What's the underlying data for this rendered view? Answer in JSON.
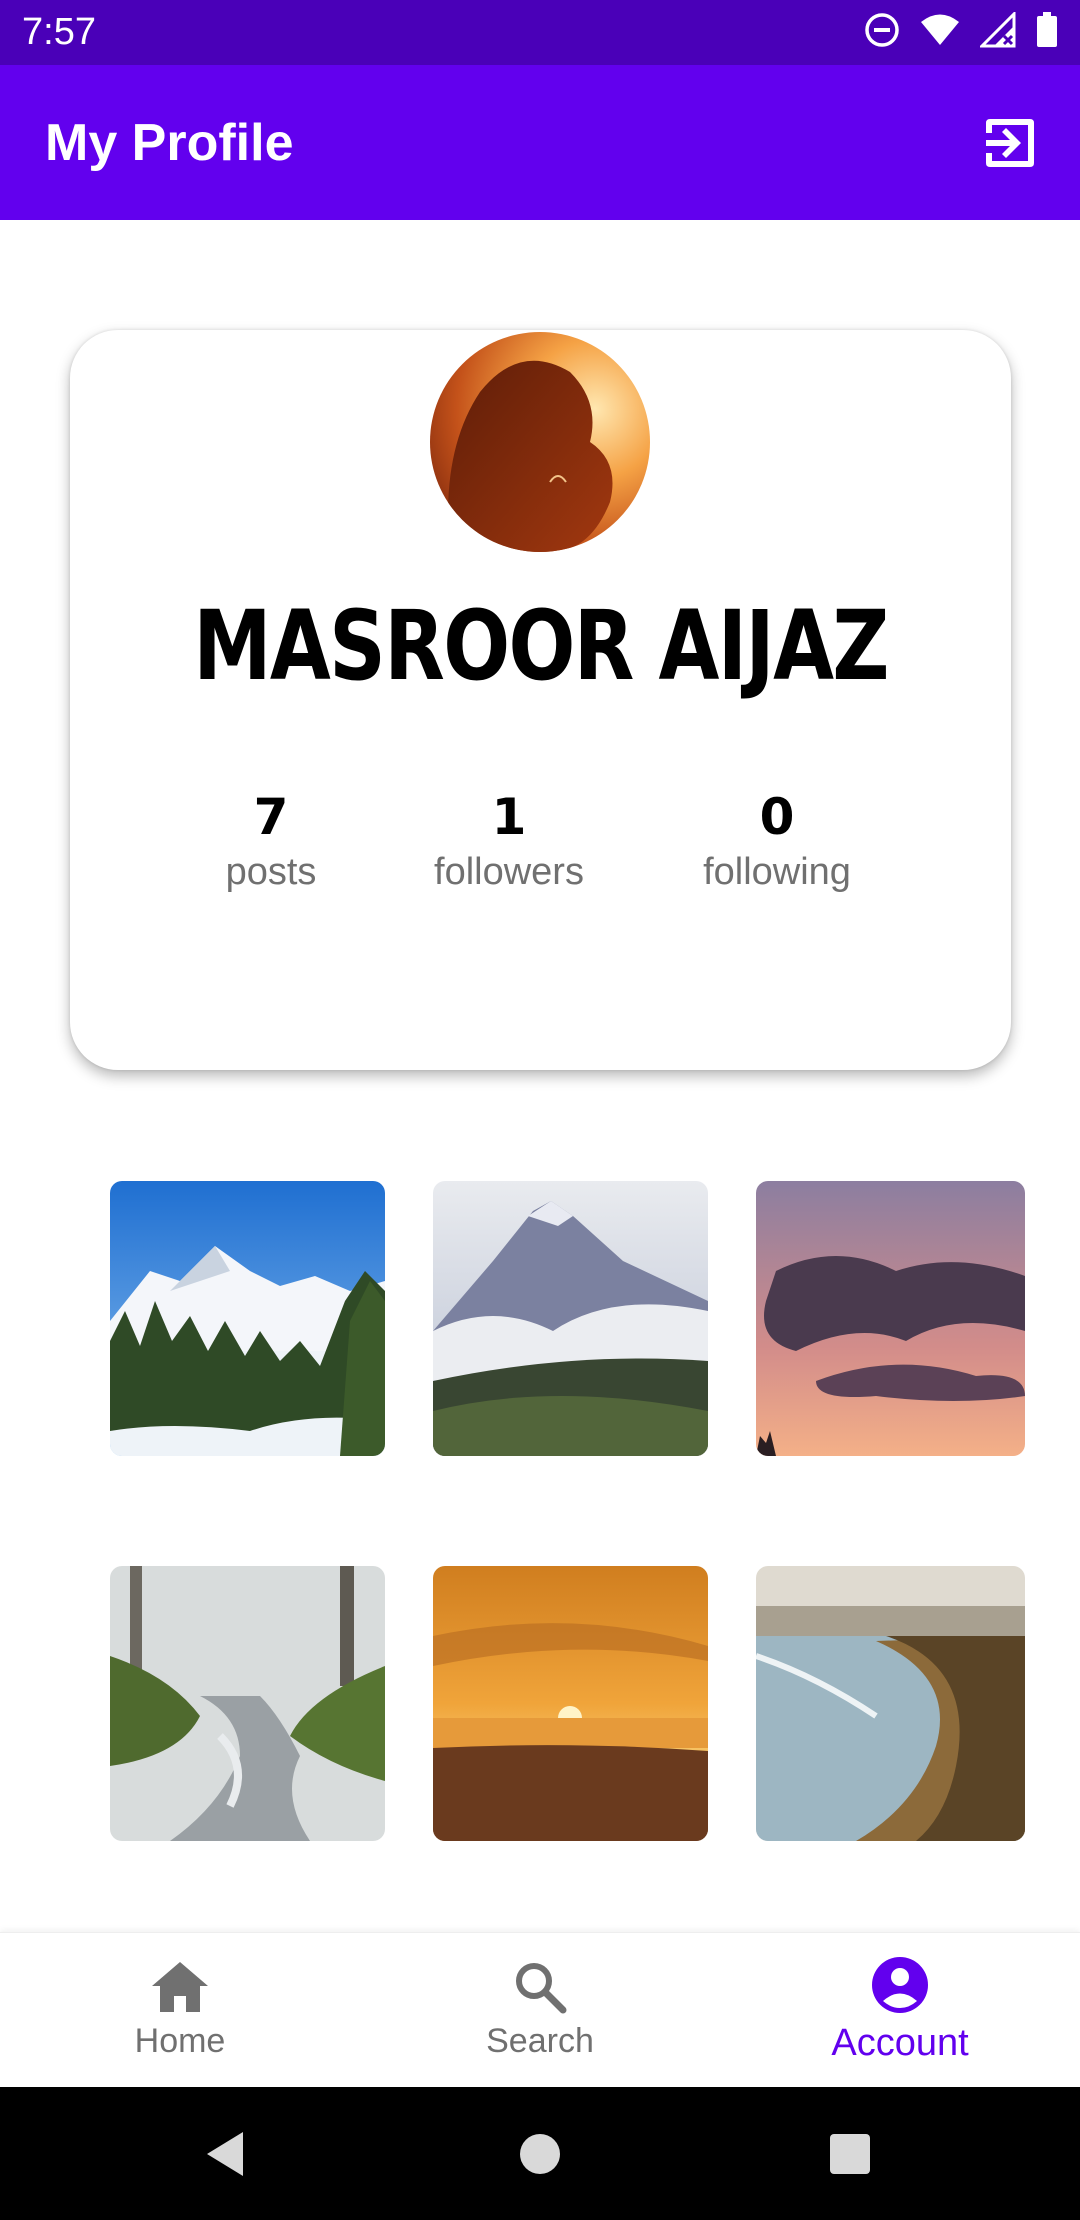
{
  "status_bar": {
    "time": "7:57"
  },
  "app_bar": {
    "title": "My Profile"
  },
  "profile": {
    "name": "MASROOR AIJAZ",
    "stats": [
      {
        "value": "7",
        "label": "posts"
      },
      {
        "value": "1",
        "label": "followers"
      },
      {
        "value": "0",
        "label": "following"
      }
    ]
  },
  "bottom_nav": {
    "items": [
      {
        "label": "Home",
        "icon": "home-icon",
        "active": false
      },
      {
        "label": "Search",
        "icon": "search-icon",
        "active": false
      },
      {
        "label": "Account",
        "icon": "account-icon",
        "active": true
      }
    ]
  },
  "colors": {
    "primary": "#6200ee",
    "status_bar": "#4a00b8",
    "inactive_nav": "#707070"
  }
}
